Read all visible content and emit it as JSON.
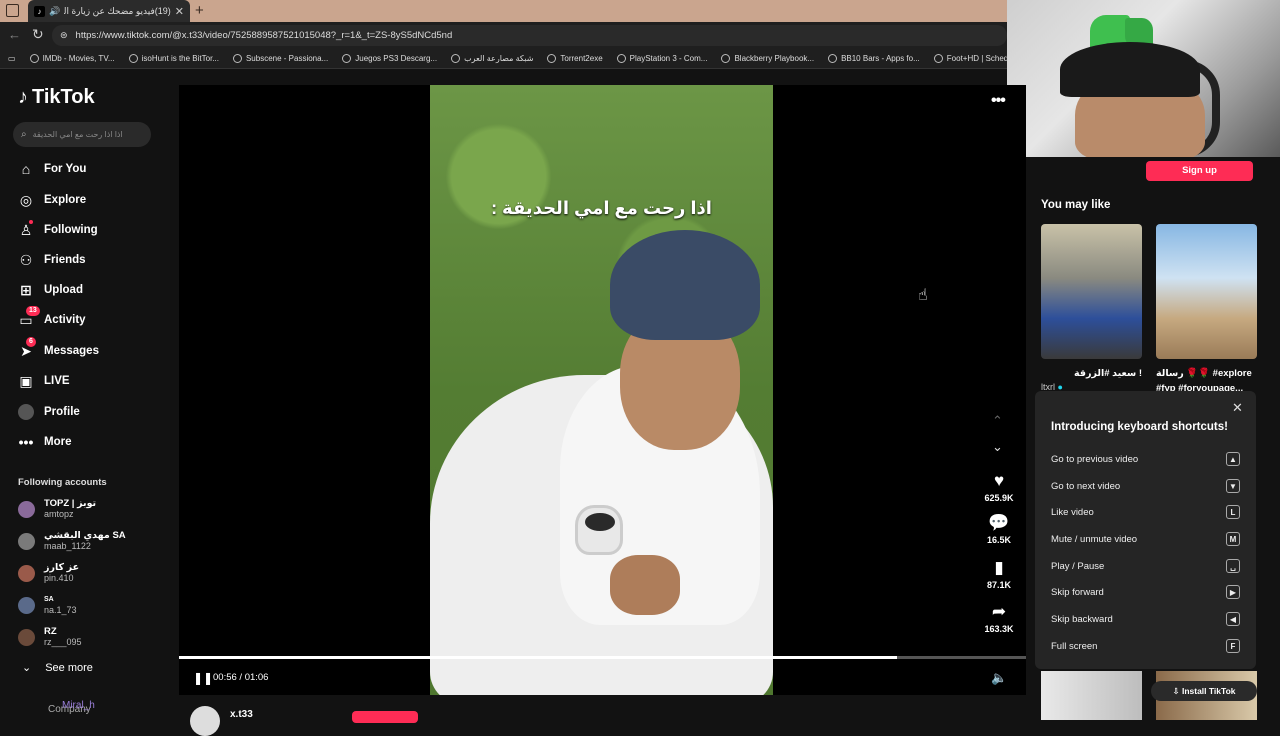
{
  "browser": {
    "tab_title": "(19)فيديو مضحك عن زيارة الحـ",
    "url": "https://www.tiktok.com/@x.t33/video/7525889587521015048?_r=1&_t=ZS-8yS5dNCd5nd",
    "bookmarks": [
      "IMDb - Movies, TV...",
      "isoHunt is the BitTor...",
      "Subscene - Passiona...",
      "Juegos PS3 Descarg...",
      "شبكة مصارعة العرب",
      "Torrent2exe",
      "PlayStation 3 - Com...",
      "Blackberry Playbook...",
      "BB10 Bars - Apps fo...",
      "Foot+HD | Schedule"
    ]
  },
  "sidebar": {
    "logo": "TikTok",
    "search_placeholder": "اذا اذا رحت مع امي الحديقة",
    "nav": [
      {
        "label": "For You",
        "icon": "home-icon",
        "badge": ""
      },
      {
        "label": "Explore",
        "icon": "compass-icon",
        "badge": ""
      },
      {
        "label": "Following",
        "icon": "following-icon",
        "badge": ""
      },
      {
        "label": "Friends",
        "icon": "friends-icon",
        "badge": ""
      },
      {
        "label": "Upload",
        "icon": "upload-icon",
        "badge": ""
      },
      {
        "label": "Activity",
        "icon": "activity-icon",
        "badge": "13"
      },
      {
        "label": "Messages",
        "icon": "messages-icon",
        "badge": "6"
      },
      {
        "label": "LIVE",
        "icon": "live-icon",
        "badge": ""
      },
      {
        "label": "Profile",
        "icon": "profile-icon",
        "badge": ""
      },
      {
        "label": "More",
        "icon": "more-icon",
        "badge": ""
      }
    ],
    "following_title": "Following accounts",
    "accounts": [
      {
        "name": "TOPZ | توبز",
        "handle": "amtopz"
      },
      {
        "name": "مهدي البقشي SA",
        "handle": "maab_1122"
      },
      {
        "name": "عز كارز",
        "handle": "pin.410"
      },
      {
        "name": "SA",
        "handle": "na.1_73"
      },
      {
        "name": "RZ",
        "handle": "rz___095"
      }
    ],
    "see_more": "See more",
    "company": "Company",
    "watermark": "Miral_h"
  },
  "video": {
    "caption": "اذا رحت مع امي الحديقة :",
    "time": "00:56 / 01:06",
    "progress": 0.848,
    "likes": "625.9K",
    "comments": "16.5K",
    "saves": "87.1K",
    "shares": "163.3K",
    "author": "x.t33"
  },
  "right": {
    "signup": "Sign up",
    "you_may_like": "You may like",
    "thumb1_caption": "! سعيد #الزرقة",
    "thumb1_user": "ltxrl",
    "thumb2_caption": "رسالة 🌹🌹 #explore #fyp #foryoupage...",
    "shortcuts": {
      "title": "Introducing keyboard shortcuts!",
      "items": [
        {
          "label": "Go to previous video",
          "key": "▲"
        },
        {
          "label": "Go to next video",
          "key": "▼"
        },
        {
          "label": "Like video",
          "key": "L"
        },
        {
          "label": "Mute / unmute video",
          "key": "M"
        },
        {
          "label": "Play / Pause",
          "key": "␣"
        },
        {
          "label": "Skip forward",
          "key": "▶"
        },
        {
          "label": "Skip backward",
          "key": "◀"
        },
        {
          "label": "Full screen",
          "key": "F"
        }
      ]
    },
    "install": "Install TikTok"
  }
}
